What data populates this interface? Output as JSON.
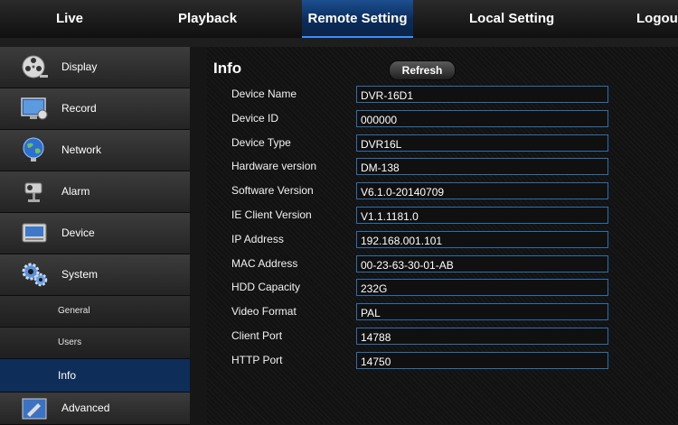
{
  "topnav": {
    "tabs": [
      {
        "label": "Live"
      },
      {
        "label": "Playback"
      },
      {
        "label": "Remote Setting"
      },
      {
        "label": "Local Setting"
      },
      {
        "label": "Logou"
      }
    ]
  },
  "sidebar": {
    "items": [
      {
        "label": "Display",
        "icon": "film-reel-icon"
      },
      {
        "label": "Record",
        "icon": "monitor-camera-icon"
      },
      {
        "label": "Network",
        "icon": "globe-icon"
      },
      {
        "label": "Alarm",
        "icon": "security-camera-icon"
      },
      {
        "label": "Device",
        "icon": "hard-drive-icon"
      },
      {
        "label": "System",
        "icon": "gears-icon"
      },
      {
        "label": "General"
      },
      {
        "label": "Users"
      },
      {
        "label": "Info"
      },
      {
        "label": "Advanced",
        "icon": "advanced-tools-icon"
      }
    ]
  },
  "info": {
    "title": "Info",
    "refresh_label": "Refresh",
    "rows": [
      {
        "label": "Device Name",
        "value": "DVR-16D1"
      },
      {
        "label": "Device ID",
        "value": "000000"
      },
      {
        "label": "Device Type",
        "value": "DVR16L"
      },
      {
        "label": "Hardware version",
        "value": "DM-138"
      },
      {
        "label": "Software Version",
        "value": "V6.1.0-20140709"
      },
      {
        "label": "IE Client Version",
        "value": "V1.1.1181.0"
      },
      {
        "label": "IP Address",
        "value": "192.168.001.101"
      },
      {
        "label": "MAC Address",
        "value": "00-23-63-30-01-AB"
      },
      {
        "label": "HDD Capacity",
        "value": "232G"
      },
      {
        "label": "Video Format",
        "value": "PAL"
      },
      {
        "label": "Client Port",
        "value": "14788"
      },
      {
        "label": "HTTP Port",
        "value": "14750"
      }
    ]
  },
  "colors": {
    "accent": "#2b6fb0",
    "active_tab": "#1d4f8f",
    "active_sub": "#0e2d58"
  }
}
